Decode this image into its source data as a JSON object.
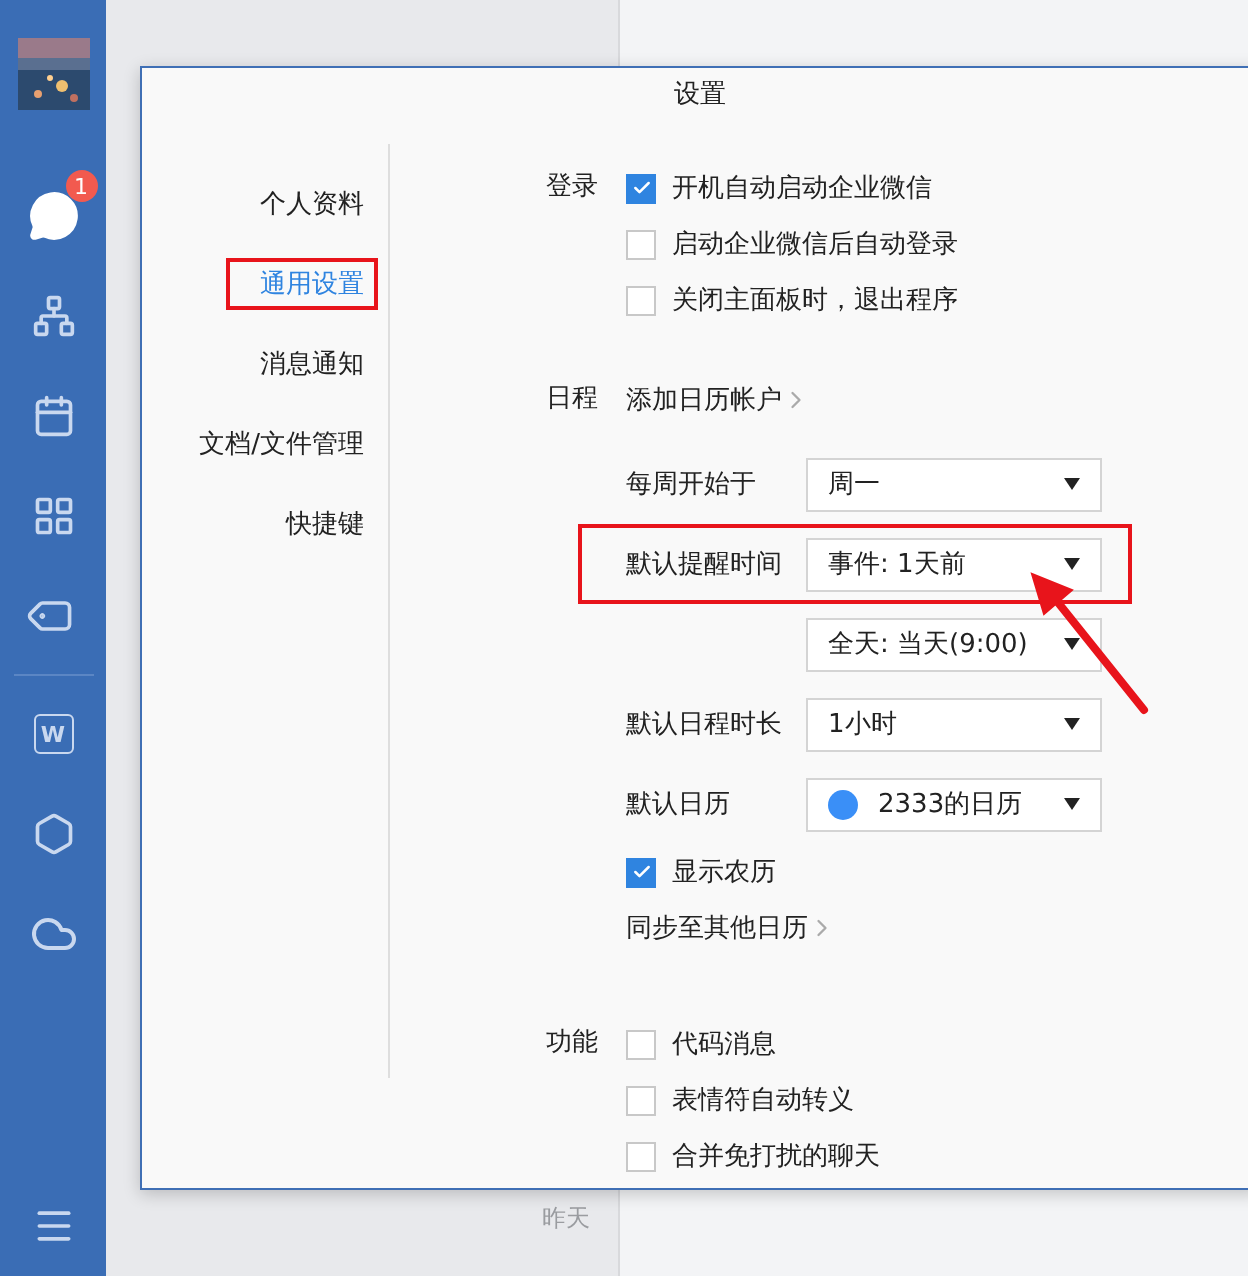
{
  "sidebar": {
    "badge": "1",
    "doc_letter": "W"
  },
  "chat_list": {
    "time": "昨天"
  },
  "dialog": {
    "title": "设置",
    "nav": [
      {
        "label": "个人资料",
        "selected": false,
        "annotated": false
      },
      {
        "label": "通用设置",
        "selected": true,
        "annotated": true
      },
      {
        "label": "消息通知",
        "selected": false,
        "annotated": false
      },
      {
        "label": "文档/文件管理",
        "selected": false,
        "annotated": false
      },
      {
        "label": "快捷键",
        "selected": false,
        "annotated": false
      }
    ],
    "sections": [
      {
        "label": "登录",
        "rows": [
          {
            "kind": "checkbox",
            "label": "开机自动启动企业微信",
            "checked": true
          },
          {
            "kind": "checkbox",
            "label": "启动企业微信后自动登录",
            "checked": false
          },
          {
            "kind": "checkbox",
            "label": "关闭主面板时，退出程序",
            "checked": false
          }
        ]
      },
      {
        "label": "日程",
        "rows": [
          {
            "kind": "link",
            "label": "添加日历帐户"
          },
          {
            "kind": "select",
            "label": "每周开始于",
            "value": "周一",
            "annotated": false
          },
          {
            "kind": "select",
            "label": "默认提醒时间",
            "value": "事件: 1天前",
            "annotated": true
          },
          {
            "kind": "select",
            "value": "全天: 当天(9:00)",
            "annotated": false
          },
          {
            "kind": "select",
            "label": "默认日程时长",
            "value": "1小时",
            "annotated": false
          },
          {
            "kind": "select",
            "label": "默认日历",
            "value": "2333的日历",
            "color": "#3a8ff7",
            "annotated": false
          },
          {
            "kind": "checkbox",
            "label": "显示农历",
            "checked": true
          },
          {
            "kind": "link",
            "label": "同步至其他日历"
          }
        ]
      },
      {
        "label": "功能",
        "rows": [
          {
            "kind": "checkbox",
            "label": "代码消息",
            "checked": false
          },
          {
            "kind": "checkbox",
            "label": "表情符自动转义",
            "checked": false
          },
          {
            "kind": "checkbox",
            "label": "合并免打扰的聊天",
            "checked": false
          }
        ]
      }
    ]
  }
}
